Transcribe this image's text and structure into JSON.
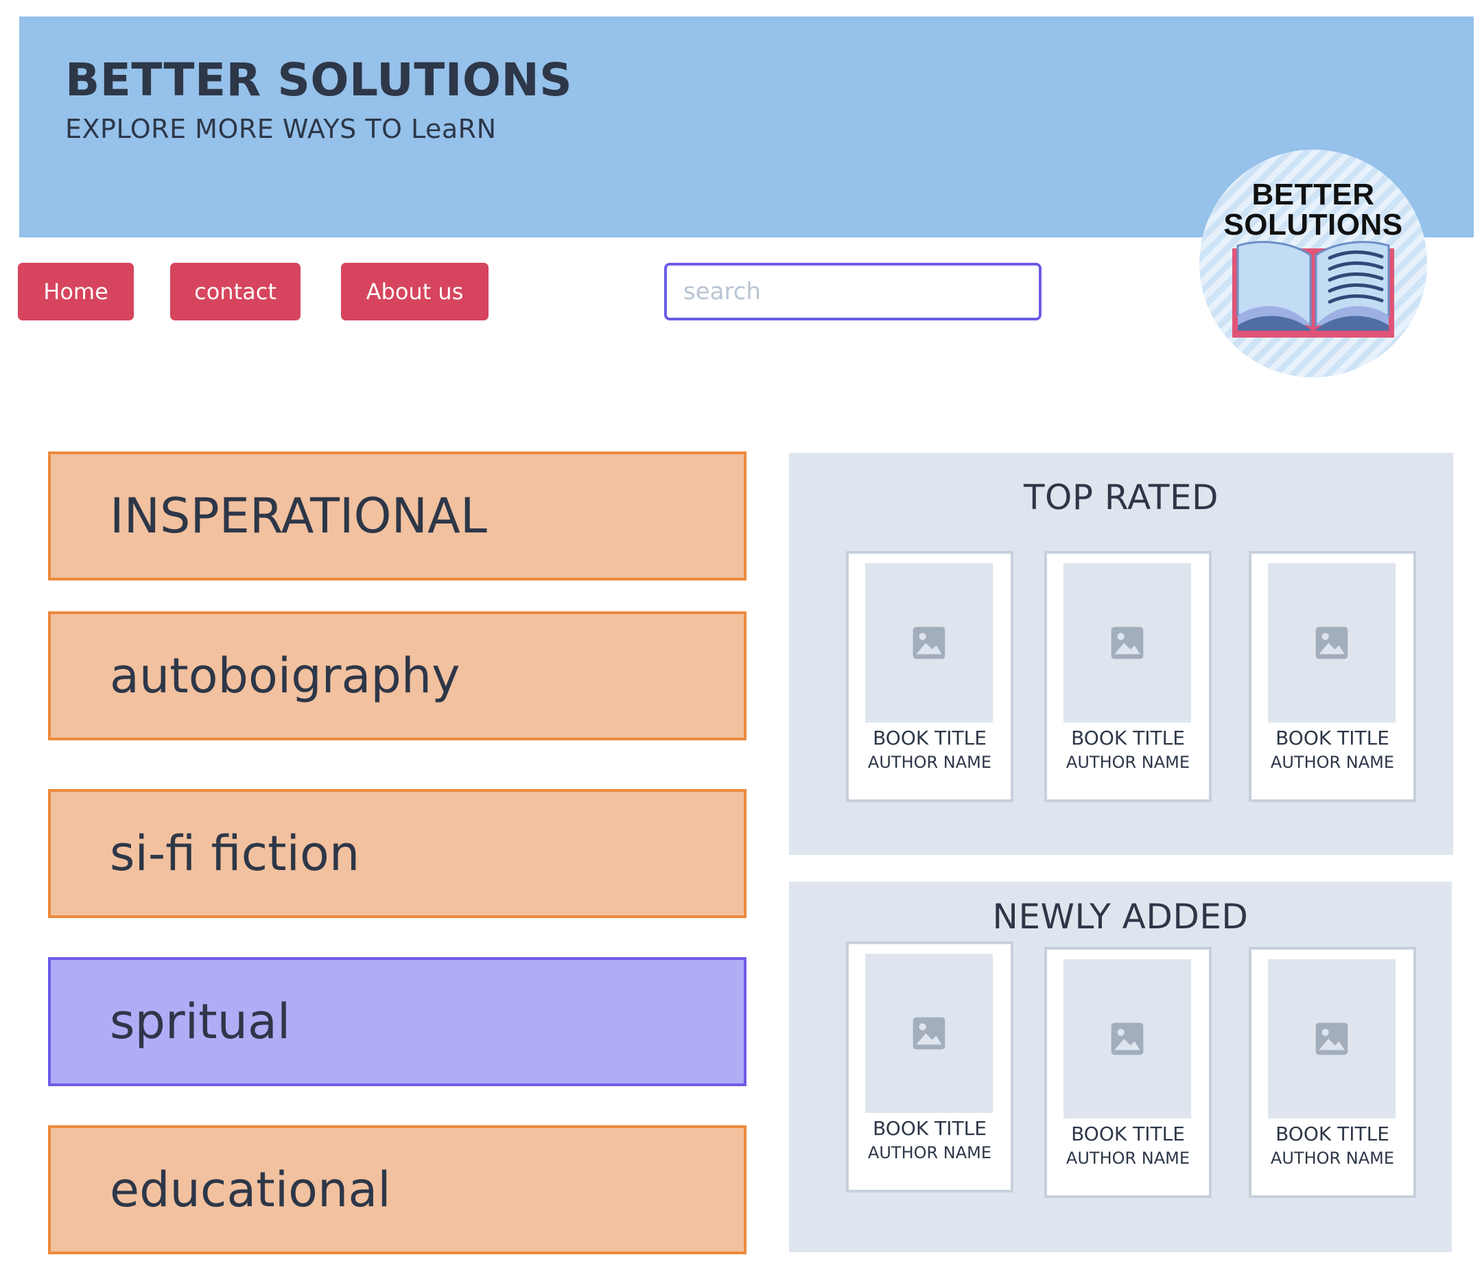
{
  "header": {
    "title": "BETTER SOLUTIONS",
    "tagline": "EXPLORE MORE WAYS TO LeaRN",
    "background_color": "#95c1ea"
  },
  "nav": {
    "items": [
      {
        "label": "Home"
      },
      {
        "label": "contact"
      },
      {
        "label": "About us"
      }
    ],
    "button_color": "#d6455d"
  },
  "search": {
    "placeholder": "search",
    "value": ""
  },
  "logo": {
    "line1": "BETTER",
    "line2": "SOLUTIONS",
    "icon": "open-book-icon"
  },
  "categories": [
    {
      "label": "INSPERATIONAL",
      "selected": false
    },
    {
      "label": "autoboigraphy",
      "selected": false
    },
    {
      "label": "si-fi fiction",
      "selected": false
    },
    {
      "label": "spritual",
      "selected": true
    },
    {
      "label": "educational",
      "selected": false
    }
  ],
  "colors": {
    "category_bg": "#f2c19f",
    "category_border": "#ec8a3c",
    "category_selected_bg": "#b0acf6",
    "category_selected_border": "#6c5ce7",
    "panel_bg": "#dfe5ee"
  },
  "top_rated": {
    "title": "TOP RATED",
    "books": [
      {
        "title": "BOOK TITLE",
        "author": "AUTHOR NAME",
        "icon": "image-placeholder-icon"
      },
      {
        "title": "BOOK TITLE",
        "author": "AUTHOR NAME",
        "icon": "image-placeholder-icon"
      },
      {
        "title": "BOOK TITLE",
        "author": "AUTHOR NAME",
        "icon": "image-placeholder-icon"
      }
    ]
  },
  "newly_added": {
    "title": "NEWLY ADDED",
    "books": [
      {
        "title": "BOOK TITLE",
        "author": "AUTHOR NAME",
        "icon": "image-placeholder-icon"
      },
      {
        "title": "BOOK TITLE",
        "author": "AUTHOR NAME",
        "icon": "image-placeholder-icon"
      },
      {
        "title": "BOOK TITLE",
        "author": "AUTHOR NAME",
        "icon": "image-placeholder-icon"
      }
    ]
  }
}
